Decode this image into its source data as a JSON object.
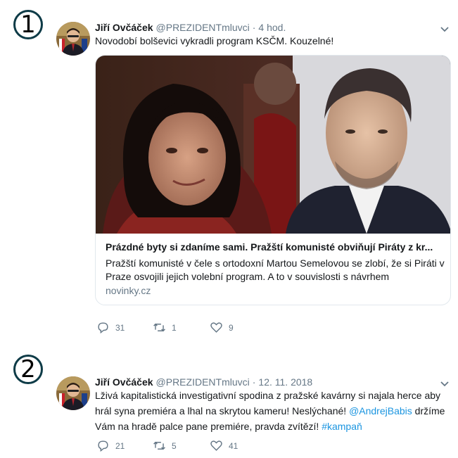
{
  "tweets": [
    {
      "marker": "1",
      "name": "Jiří Ovčáček",
      "handle": "@PREZIDENTmluvci",
      "separator": "·",
      "time": "4 hod.",
      "text": "Novodobí bolševici vykradli program KSČM. Kouzelné!",
      "card": {
        "title": "Prázdné byty si zdaníme sami. Pražští komunisté obviňují Piráty z kr...",
        "description": "Pražští komunisté v čele s ortodoxní Martou Semelovou se zlobí, že si Piráti v Praze osvojili jejich volební program. A to v souvislosti s návrhem",
        "domain": "novinky.cz"
      },
      "replies": "31",
      "retweets": "1",
      "likes": "9"
    },
    {
      "marker": "2",
      "name": "Jiří Ovčáček",
      "handle": "@PREZIDENTmluvci",
      "separator": "·",
      "time": "12. 11. 2018",
      "text_part1": "Lživá kapitalistická investigativní spodina z pražské kavárny si najala herce aby hrál syna premiéra a lhal na skrytou kameru! Neslýchané! ",
      "mention": "@AndrejBabis",
      "text_part2": " držíme Vám na hradě palce pane premiére, pravda zvítězí! ",
      "hashtag": "#kampaň",
      "replies": "21",
      "retweets": "5",
      "likes": "41"
    }
  ],
  "colors": {
    "accent": "#1b95e0",
    "secondary_text": "#657786",
    "marker_border": "#0e3b47"
  }
}
